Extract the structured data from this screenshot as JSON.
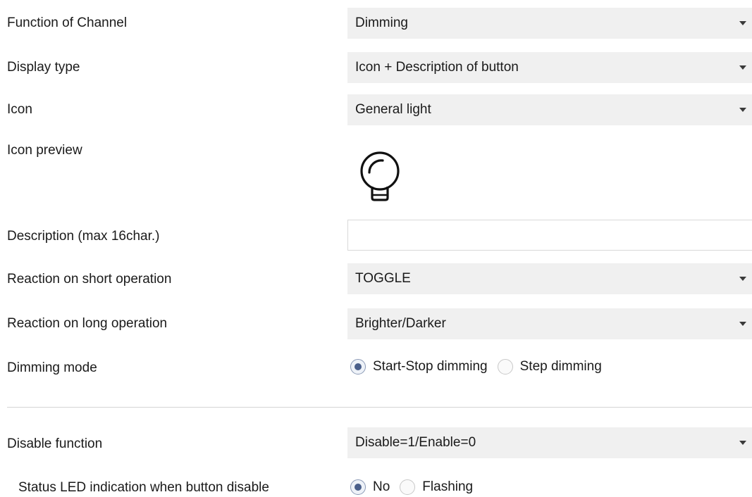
{
  "function_of_channel": {
    "label": "Function of Channel",
    "value": "Dimming"
  },
  "display_type": {
    "label": "Display type",
    "value": "Icon + Description of button"
  },
  "icon": {
    "label": "Icon",
    "value": "General light"
  },
  "icon_preview": {
    "label": "Icon preview",
    "icon": "light-bulb-icon"
  },
  "description": {
    "label": "Description (max 16char.)",
    "value": "",
    "placeholder": ""
  },
  "reaction_short": {
    "label": "Reaction on short operation",
    "value": "TOGGLE"
  },
  "reaction_long": {
    "label": "Reaction on long operation",
    "value": "Brighter/Darker"
  },
  "dimming_mode": {
    "label": "Dimming mode",
    "options": [
      "Start-Stop dimming",
      "Step dimming"
    ],
    "selected": "Start-Stop dimming"
  },
  "disable_function": {
    "label": "Disable function",
    "value": "Disable=1/Enable=0"
  },
  "status_led": {
    "label": "Status LED indication when button disable",
    "options": [
      "No",
      "Flashing"
    ],
    "selected": "No"
  },
  "colors": {
    "select_bg": "#f0f0f0",
    "radio_dot": "#4a5f8a",
    "divider": "#d4d4d4"
  }
}
